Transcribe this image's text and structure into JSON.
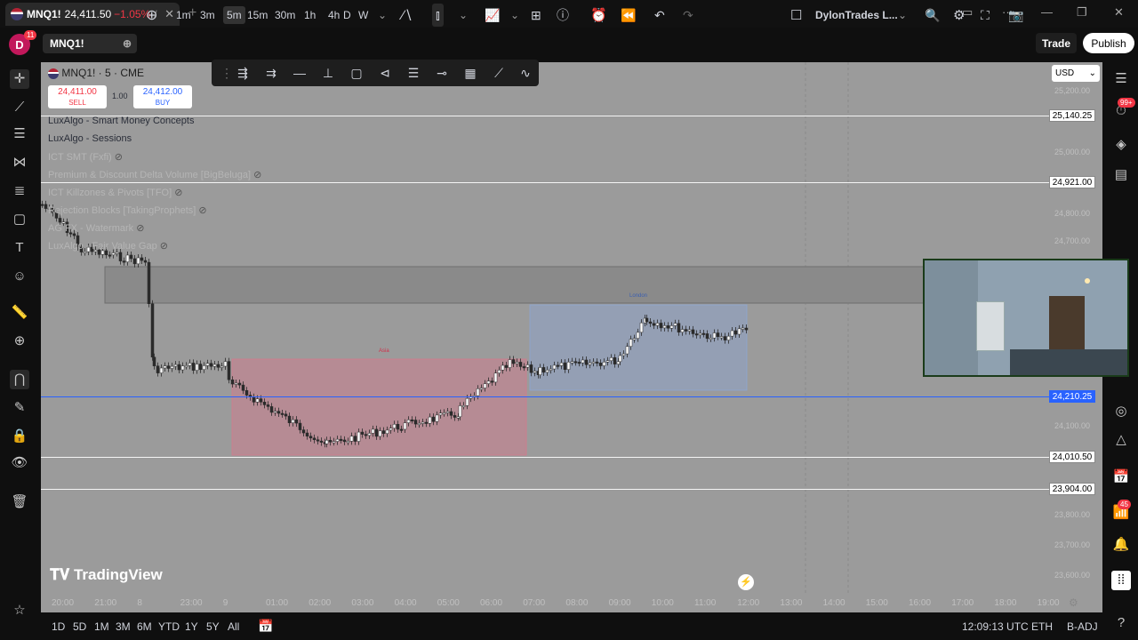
{
  "window": {
    "tab_symbol": "MNQ1!",
    "tab_price": "24,411.50",
    "tab_change": "−1.05%",
    "tab_suffix": "/",
    "new_tab": "+",
    "minimize": "—",
    "restore": "❐",
    "close": "✕"
  },
  "header": {
    "avatar_letter": "D",
    "avatar_badge": "11",
    "symbol": "MNQ1!",
    "timeframes": [
      "1m",
      "3m",
      "5m",
      "15m",
      "30m",
      "1h",
      "4h",
      "D",
      "W"
    ],
    "active_timeframe": "5m",
    "layout_name": "DylonTrades L...",
    "trade_label": "Trade",
    "publish_label": "Publish"
  },
  "chart": {
    "title": "MNQ1! · 5 · CME",
    "sell_price": "24,411.00",
    "sell_label": "SELL",
    "spread": "1.00",
    "buy_price": "24,412.00",
    "buy_label": "BUY",
    "currency": "USD",
    "indicators": [
      "LuxAlgo - Smart Money Concepts",
      "LuxAlgo - Sessions",
      "ICT SMT (Fxfi)",
      "Premium & Discount Delta Volume [BigBeluga]",
      "ICT Killzones & Pivots [TFO]",
      "Rejection Blocks [TakingProphets]",
      "AG FX - Watermark",
      "LuxAlgo - Fair Value Gap"
    ],
    "price_labels": [
      {
        "value": "25,140.25"
      },
      {
        "value": "24,921.00"
      },
      {
        "value": "24,210.25"
      },
      {
        "value": "24,010.50"
      },
      {
        "value": "23,904.00"
      }
    ],
    "axis_ticks": [
      "25,200.00",
      "25,000.00",
      "24,800.00",
      "24,700.00",
      "24,100.00",
      "23,800.00",
      "23,700.00",
      "23,600.00"
    ],
    "time_ticks": [
      "20:00",
      "21:00",
      "8",
      "23:00",
      "9",
      "01:00",
      "02:00",
      "03:00",
      "04:00",
      "05:00",
      "06:00",
      "07:00",
      "08:00",
      "09:00",
      "10:00",
      "11:00",
      "12:00",
      "13:00",
      "14:00",
      "15:00",
      "16:00",
      "17:00",
      "18:00",
      "19:00"
    ],
    "session_labels": {
      "asia": "Asia",
      "london": "London"
    },
    "watermark": "TradingView"
  },
  "bottom": {
    "ranges": [
      "1D",
      "5D",
      "1M",
      "3M",
      "6M",
      "YTD",
      "1Y",
      "5Y",
      "All"
    ],
    "clock": "12:09:13 UTC",
    "session": "ETH",
    "adjust": "B-ADJ"
  },
  "right_badges": {
    "notifications": "99+",
    "alerts": "45"
  }
}
